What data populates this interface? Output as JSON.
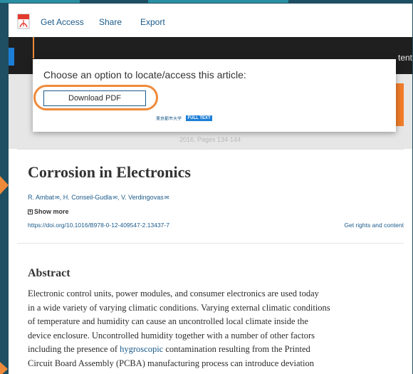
{
  "toolbar": {
    "pdf_icon": "pdf-icon",
    "get_access": "Get Access",
    "share": "Share",
    "export": "Export"
  },
  "banner": {
    "faint_left": "",
    "partial_right": "tent"
  },
  "popup": {
    "title": "Choose an option to locate/access this article:",
    "download_pdf": "Download PDF",
    "university_link": "東京都市大学",
    "full_text_badge": "FULL TEXT"
  },
  "article": {
    "pages_text": "2016, Pages 134-144",
    "title": "Corrosion in Electronics",
    "authors": [
      {
        "name": "R. Ambat"
      },
      {
        "name": "H. Conseil-Gudla"
      },
      {
        "name": "V. Verdingovas"
      }
    ],
    "show_more": "Show more",
    "doi": "https://doi.org/10.1016/B978-0-12-409547-2.13437-7",
    "rights": "Get rights and content"
  },
  "abstract": {
    "heading": "Abstract",
    "lines": [
      "Electronic control units, power modules, and consumer electronics are used today",
      "in a wide variety of varying climatic conditions. Varying external climatic conditions",
      "of temperature and humidity can cause an uncontrolled local climate inside the",
      "device enclosure. Uncontrolled humidity together with a number of other factors"
    ],
    "line5_before": "including the presence of ",
    "line5_link": "hygroscopic",
    "line5_after": " contamination resulting from the Printed",
    "line6": "Circuit Board Assembly (PCBA) manufacturing process can introduce deviation"
  },
  "colors": {
    "accent_orange": "#ef8a3a",
    "link_blue": "#1a5a8a",
    "banner_dark": "#1f1f1f"
  }
}
